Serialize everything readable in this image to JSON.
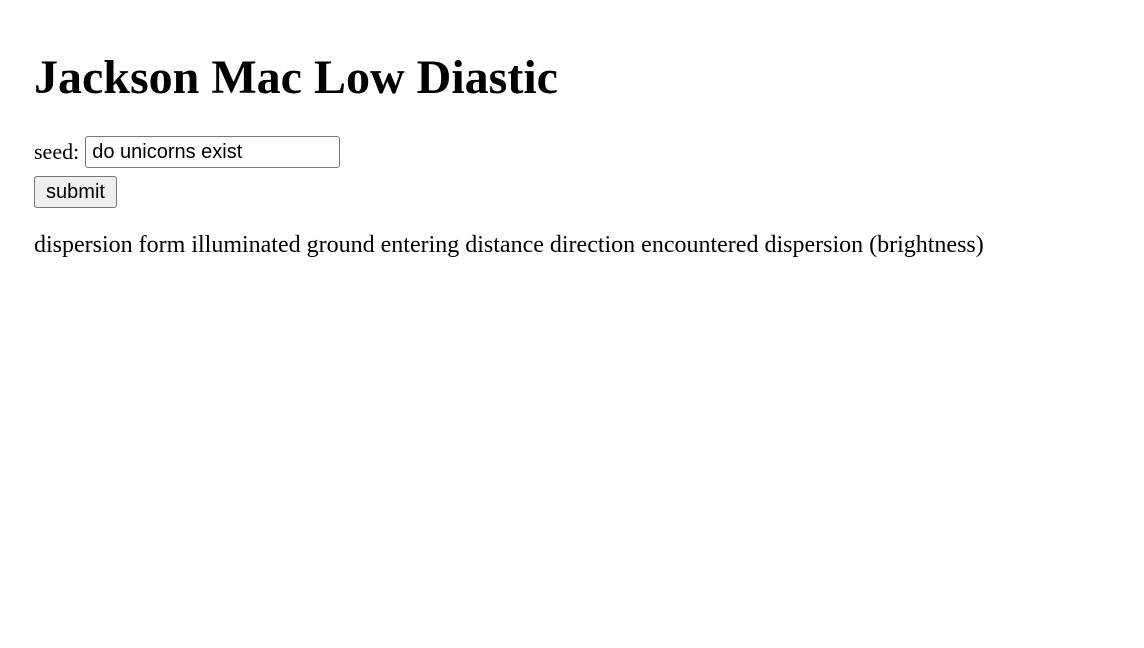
{
  "page": {
    "title": "Jackson Mac Low Diastic"
  },
  "form": {
    "seed_label": "seed:",
    "seed_value": "do unicorns exist",
    "submit_label": "submit"
  },
  "output": {
    "text": "dispersion form illuminated ground entering distance direction encountered dispersion (brightness)"
  }
}
